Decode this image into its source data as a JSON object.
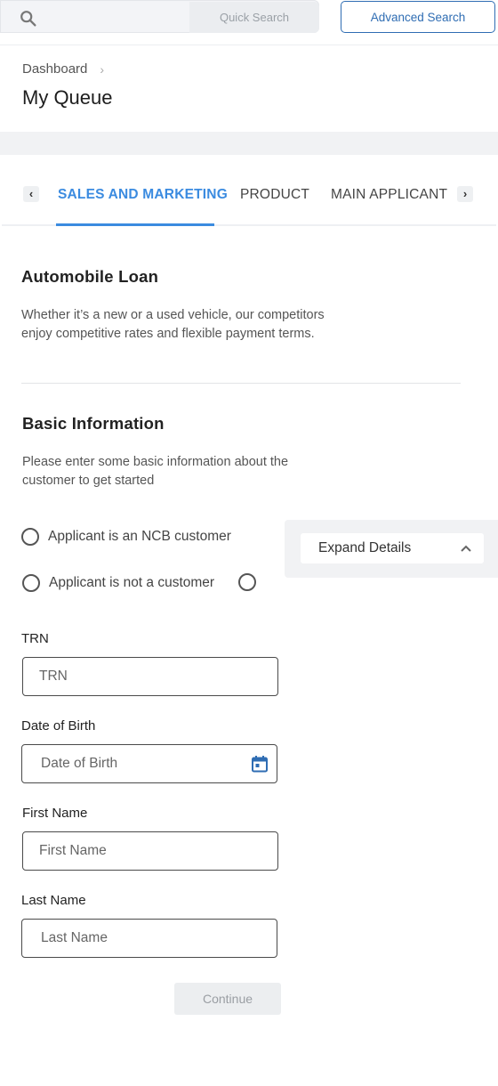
{
  "search": {
    "placeholder": "",
    "quick_label": "Quick Search",
    "advanced_label": "Advanced Search"
  },
  "header": {
    "breadcrumb": "Dashboard",
    "title": "My Queue"
  },
  "tabs": [
    {
      "label": "SALES AND MARKETING",
      "active": true
    },
    {
      "label": "PRODUCT",
      "active": false
    },
    {
      "label": "MAIN APPLICANT",
      "active": false
    }
  ],
  "loan": {
    "title": "Automobile Loan",
    "desc_line1": "Whether it’s a new or a used vehicle, our competitors",
    "desc_line2": "enjoy competitive rates and flexible payment terms."
  },
  "basic": {
    "title": "Basic Information",
    "desc_line1": "Please enter some basic information about the",
    "desc_line2": "customer to get started"
  },
  "radios": {
    "ncb_customer": "Applicant is an NCB customer",
    "not_customer": "Applicant is not a customer"
  },
  "expand": {
    "label": "Expand Details"
  },
  "fields": {
    "trn": {
      "label": "TRN",
      "placeholder": "TRN"
    },
    "dob": {
      "label": "Date of Birth",
      "placeholder": "Date of Birth"
    },
    "first_name": {
      "label": "First Name",
      "placeholder": "First Name"
    },
    "last_name": {
      "label": "Last Name",
      "placeholder": "Last Name"
    }
  },
  "actions": {
    "continue_label": "Continue"
  },
  "colors": {
    "accent": "#3b8be0",
    "outline_button": "#2f6db3"
  }
}
